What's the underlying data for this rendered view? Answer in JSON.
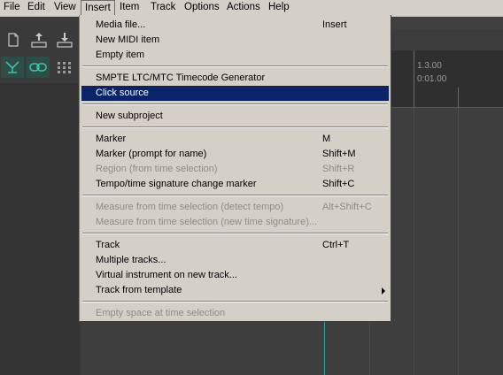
{
  "menubar": {
    "items": [
      "File",
      "Edit",
      "View",
      "Insert",
      "Item",
      "Track",
      "Options",
      "Actions",
      "Help"
    ]
  },
  "ruler": {
    "measure": "1.3.00",
    "time": "0:01.00"
  },
  "insert_menu": {
    "items": [
      {
        "label": "Media file...",
        "shortcut": "Insert",
        "disabled": false
      },
      {
        "label": "New MIDI item",
        "shortcut": "",
        "disabled": false
      },
      {
        "label": "Empty item",
        "shortcut": "",
        "disabled": false
      },
      {
        "label": "SMPTE LTC/MTC Timecode Generator",
        "shortcut": "",
        "disabled": false
      },
      {
        "label": "Click source",
        "shortcut": "",
        "disabled": false,
        "highlighted": true
      },
      {
        "label": "New subproject",
        "shortcut": "",
        "disabled": false
      },
      {
        "label": "Marker",
        "shortcut": "M",
        "disabled": false
      },
      {
        "label": "Marker (prompt for name)",
        "shortcut": "Shift+M",
        "disabled": false
      },
      {
        "label": "Region (from time selection)",
        "shortcut": "Shift+R",
        "disabled": true
      },
      {
        "label": "Tempo/time signature change marker",
        "shortcut": "Shift+C",
        "disabled": false
      },
      {
        "label": "Measure from time selection (detect tempo)",
        "shortcut": "Alt+Shift+C",
        "disabled": true
      },
      {
        "label": "Measure from time selection (new time signature)...",
        "shortcut": "",
        "disabled": true
      },
      {
        "label": "Track",
        "shortcut": "Ctrl+T",
        "disabled": false
      },
      {
        "label": "Multiple tracks...",
        "shortcut": "",
        "disabled": false
      },
      {
        "label": "Virtual instrument on new track...",
        "shortcut": "",
        "disabled": false
      },
      {
        "label": "Track from template",
        "shortcut": "",
        "disabled": false,
        "submenu": true
      },
      {
        "label": "Empty space at time selection",
        "shortcut": "",
        "disabled": true
      }
    ]
  },
  "colors": {
    "menu_bg": "#d4d0c8",
    "highlight": "#0a246a",
    "disabled_text": "#8e8c87",
    "app_bg": "#333333",
    "cursor_line": "#2fa39a"
  },
  "toolbar": {
    "icons": [
      "new-file-icon",
      "upload-icon",
      "download-icon",
      "trim-icon",
      "link-icon",
      "grid-icon"
    ]
  }
}
